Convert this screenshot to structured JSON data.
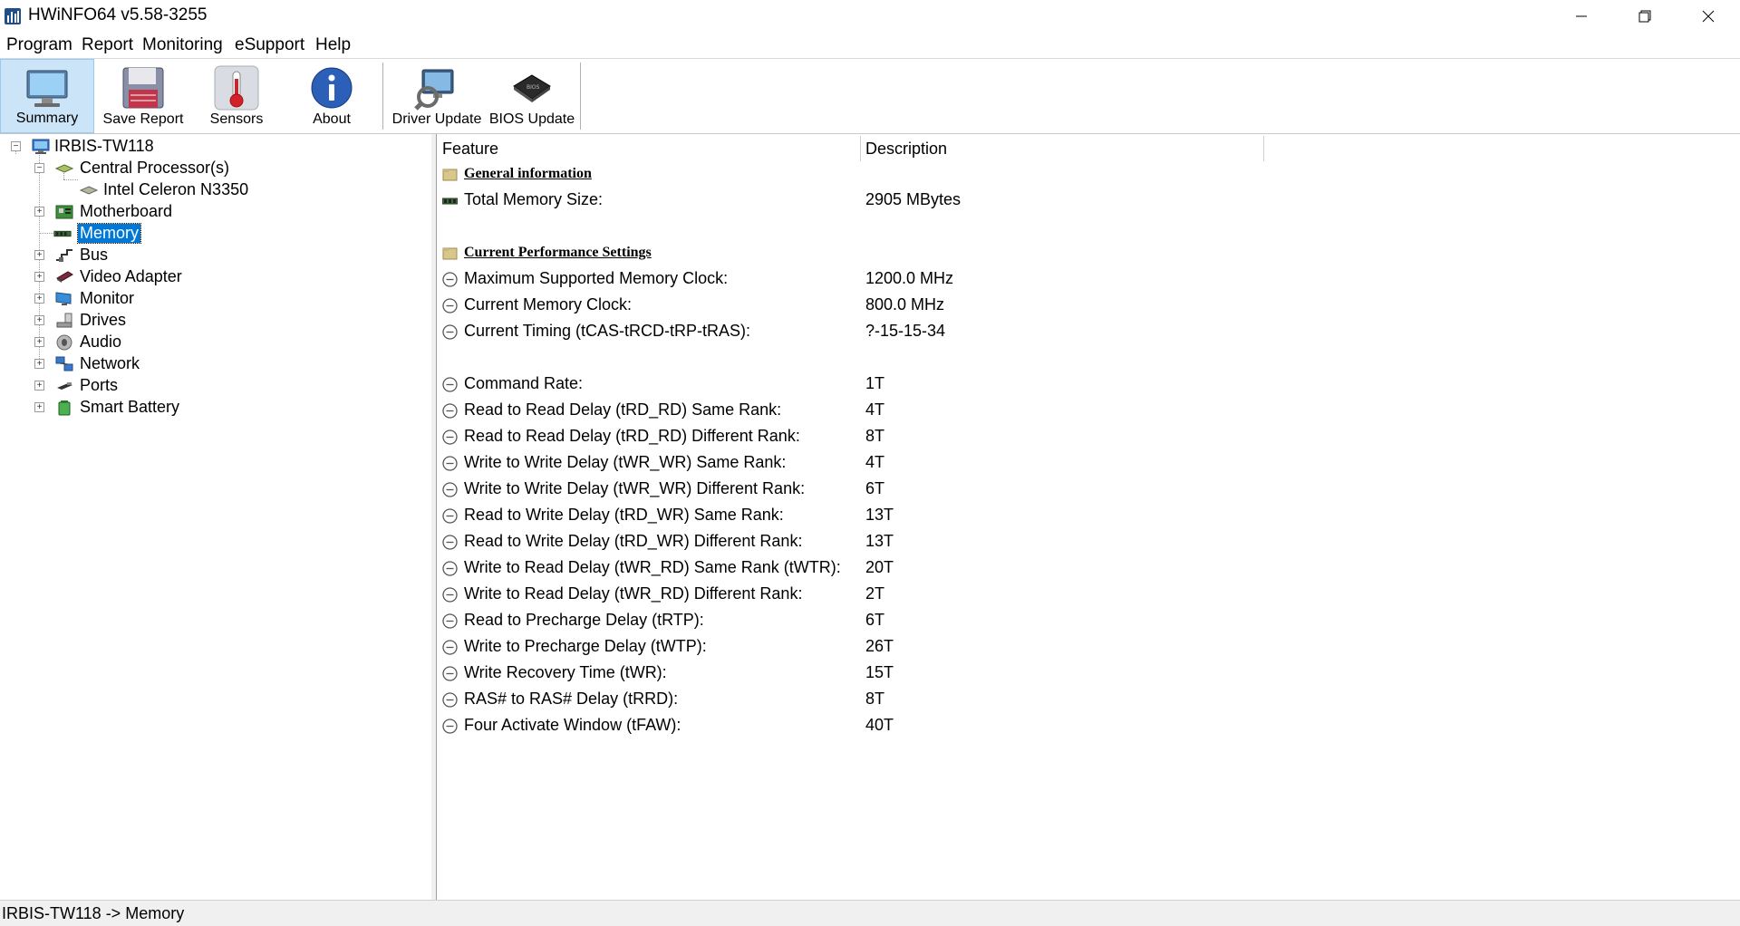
{
  "window": {
    "title": "HWiNFO64 v5.58-3255"
  },
  "menu": [
    "Program",
    "Report",
    "Monitoring",
    "eSupport",
    "Help"
  ],
  "toolbar": [
    {
      "label": "Summary",
      "icon": "monitor-icon"
    },
    {
      "label": "Save Report",
      "icon": "floppy-icon"
    },
    {
      "label": "Sensors",
      "icon": "thermometer-icon"
    },
    {
      "label": "About",
      "icon": "info-icon"
    },
    {
      "label": "Driver Update",
      "icon": "driver-update-icon"
    },
    {
      "label": "BIOS Update",
      "icon": "chip-icon"
    }
  ],
  "tree": [
    {
      "label": "IRBIS-TW118",
      "icon": "computer-icon",
      "expander": "−"
    },
    {
      "label": "Central Processor(s)",
      "icon": "cpu-icon",
      "expander": "−"
    },
    {
      "label": "Intel Celeron N3350",
      "icon": "cpu-icon",
      "expander": ""
    },
    {
      "label": "Motherboard",
      "icon": "motherboard-icon",
      "expander": "+"
    },
    {
      "label": "Memory",
      "icon": "memory-icon",
      "expander": "",
      "selected": true
    },
    {
      "label": "Bus",
      "icon": "bus-icon",
      "expander": "+"
    },
    {
      "label": "Video Adapter",
      "icon": "video-adapter-icon",
      "expander": "+"
    },
    {
      "label": "Monitor",
      "icon": "monitor-icon",
      "expander": "+"
    },
    {
      "label": "Drives",
      "icon": "drives-icon",
      "expander": "+"
    },
    {
      "label": "Audio",
      "icon": "audio-icon",
      "expander": "+"
    },
    {
      "label": "Network",
      "icon": "network-icon",
      "expander": "+"
    },
    {
      "label": "Ports",
      "icon": "ports-icon",
      "expander": "+"
    },
    {
      "label": "Smart Battery",
      "icon": "battery-icon",
      "expander": "+"
    }
  ],
  "detail": {
    "columns": [
      "Feature",
      "Description"
    ],
    "rows": [
      {
        "type": "section",
        "feature": "General information",
        "desc": ""
      },
      {
        "type": "item",
        "icon": "memory-icon",
        "feature": "Total Memory Size:",
        "desc": "2905 MBytes"
      },
      {
        "type": "blank",
        "feature": "",
        "desc": ""
      },
      {
        "type": "section",
        "feature": "Current Performance Settings",
        "desc": ""
      },
      {
        "type": "item",
        "icon": "clock-icon",
        "feature": "Maximum Supported Memory Clock:",
        "desc": "1200.0 MHz"
      },
      {
        "type": "item",
        "icon": "clock-icon",
        "feature": "Current Memory Clock:",
        "desc": "800.0 MHz"
      },
      {
        "type": "item",
        "icon": "clock-icon",
        "feature": "Current Timing (tCAS-tRCD-tRP-tRAS):",
        "desc": "?-15-15-34"
      },
      {
        "type": "blank",
        "feature": "",
        "desc": ""
      },
      {
        "type": "item",
        "icon": "clock-icon",
        "feature": "Command Rate:",
        "desc": "1T"
      },
      {
        "type": "item",
        "icon": "clock-icon",
        "feature": "Read to Read Delay (tRD_RD) Same Rank:",
        "desc": "4T"
      },
      {
        "type": "item",
        "icon": "clock-icon",
        "feature": "Read to Read Delay (tRD_RD) Different Rank:",
        "desc": "8T"
      },
      {
        "type": "item",
        "icon": "clock-icon",
        "feature": "Write to Write Delay (tWR_WR) Same Rank:",
        "desc": "4T"
      },
      {
        "type": "item",
        "icon": "clock-icon",
        "feature": "Write to Write Delay (tWR_WR) Different Rank:",
        "desc": "6T"
      },
      {
        "type": "item",
        "icon": "clock-icon",
        "feature": "Read to Write Delay (tRD_WR) Same Rank:",
        "desc": "13T"
      },
      {
        "type": "item",
        "icon": "clock-icon",
        "feature": "Read to Write Delay (tRD_WR) Different Rank:",
        "desc": "13T"
      },
      {
        "type": "item",
        "icon": "clock-icon",
        "feature": "Write to Read Delay (tWR_RD) Same Rank (tWTR):",
        "desc": "20T"
      },
      {
        "type": "item",
        "icon": "clock-icon",
        "feature": "Write to Read Delay (tWR_RD) Different Rank:",
        "desc": "2T"
      },
      {
        "type": "item",
        "icon": "clock-icon",
        "feature": "Read to Precharge Delay (tRTP):",
        "desc": "6T"
      },
      {
        "type": "item",
        "icon": "clock-icon",
        "feature": "Write to Precharge Delay (tWTP):",
        "desc": "26T"
      },
      {
        "type": "item",
        "icon": "clock-icon",
        "feature": "Write Recovery Time (tWR):",
        "desc": "15T"
      },
      {
        "type": "item",
        "icon": "clock-icon",
        "feature": "RAS# to RAS# Delay (tRRD):",
        "desc": "8T"
      },
      {
        "type": "item",
        "icon": "clock-icon",
        "feature": "Four Activate Window (tFAW):",
        "desc": "40T"
      }
    ]
  },
  "status": {
    "text": "IRBIS-TW118 -> Memory"
  },
  "colors": {
    "selection": "#0078d7",
    "toolbar_active": "#cce4f7"
  }
}
